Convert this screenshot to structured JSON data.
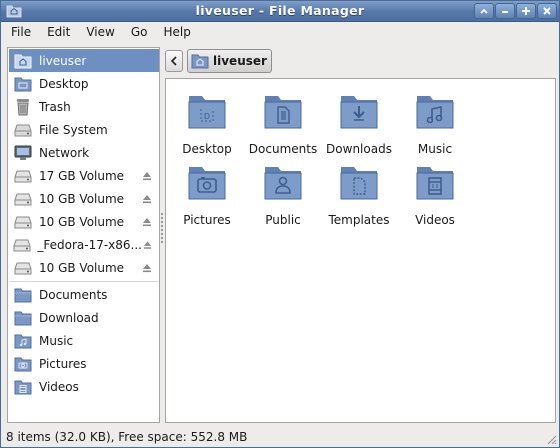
{
  "window": {
    "title": "liveuser - File Manager",
    "title_color": "#ffffff",
    "accent": "#6d8fc2"
  },
  "menubar": {
    "items": [
      "File",
      "Edit",
      "View",
      "Go",
      "Help"
    ]
  },
  "sidebar": {
    "items": [
      {
        "label": "liveuser",
        "icon": "home-folder-icon",
        "selected": true
      },
      {
        "label": "Desktop",
        "icon": "desktop-folder-icon"
      },
      {
        "label": "Trash",
        "icon": "trash-icon"
      },
      {
        "label": "File System",
        "icon": "drive-icon"
      },
      {
        "label": "Network",
        "icon": "network-icon"
      },
      {
        "label": "17 GB Volume",
        "icon": "drive-icon",
        "eject": true
      },
      {
        "label": "10 GB Volume",
        "icon": "drive-icon",
        "eject": true
      },
      {
        "label": "10 GB Volume",
        "icon": "drive-icon",
        "eject": true
      },
      {
        "label": "_Fedora-17-x86...",
        "icon": "drive-icon",
        "eject": true
      },
      {
        "label": "10 GB Volume",
        "icon": "drive-icon",
        "eject": true
      },
      {
        "label": "Documents",
        "icon": "folder-icon"
      },
      {
        "label": "Download",
        "icon": "folder-icon"
      },
      {
        "label": "Music",
        "icon": "music-folder-icon"
      },
      {
        "label": "Pictures",
        "icon": "pictures-folder-icon"
      },
      {
        "label": "Videos",
        "icon": "videos-folder-icon"
      }
    ]
  },
  "pathbar": {
    "current": "liveuser"
  },
  "files": [
    {
      "label": "Desktop",
      "icon": "desktop-folder-icon"
    },
    {
      "label": "Documents",
      "icon": "documents-folder-icon"
    },
    {
      "label": "Downloads",
      "icon": "downloads-folder-icon"
    },
    {
      "label": "Music",
      "icon": "music-folder-icon"
    },
    {
      "label": "Pictures",
      "icon": "pictures-folder-icon"
    },
    {
      "label": "Public",
      "icon": "public-folder-icon"
    },
    {
      "label": "Templates",
      "icon": "templates-folder-icon"
    },
    {
      "label": "Videos",
      "icon": "videos-folder-icon"
    }
  ],
  "statusbar": {
    "text": "8 items (32.0 KB), Free space: 552.8 MB"
  }
}
